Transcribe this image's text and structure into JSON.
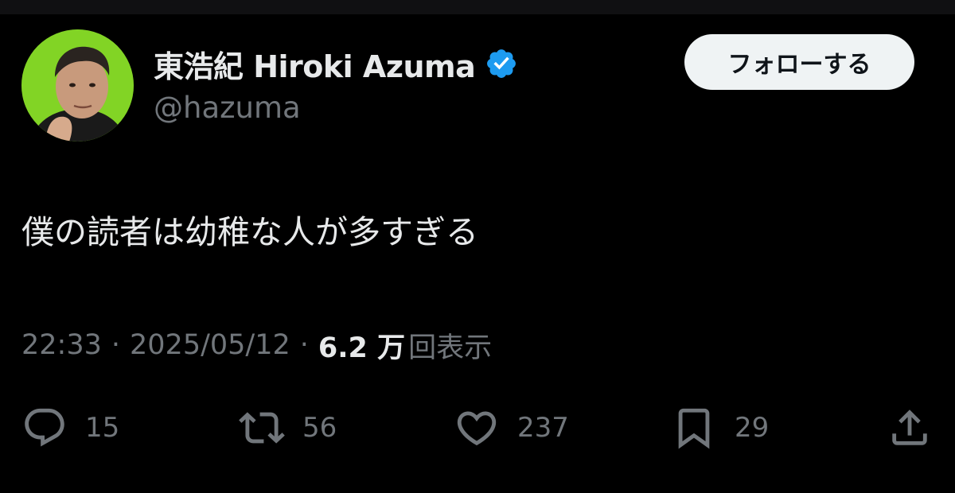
{
  "user": {
    "display_name": "東浩紀 Hiroki Azuma",
    "handle": "@hazuma",
    "verified": true,
    "verified_color": "#1d9bf0",
    "avatar_bg_color": "#7ed321"
  },
  "follow_button": {
    "label": "フォローする"
  },
  "tweet": {
    "text": "僕の読者は幼稚な人が多すぎる",
    "time": "22:33",
    "date": "2025/05/12",
    "separator": "·",
    "views_count": "6.2 万",
    "views_label": "回表示"
  },
  "actions": {
    "reply": {
      "icon": "reply-icon",
      "count": "15"
    },
    "repost": {
      "icon": "repost-icon",
      "count": "56"
    },
    "like": {
      "icon": "heart-icon",
      "count": "237"
    },
    "bookmark": {
      "icon": "bookmark-icon",
      "count": "29"
    },
    "share": {
      "icon": "share-icon"
    }
  }
}
